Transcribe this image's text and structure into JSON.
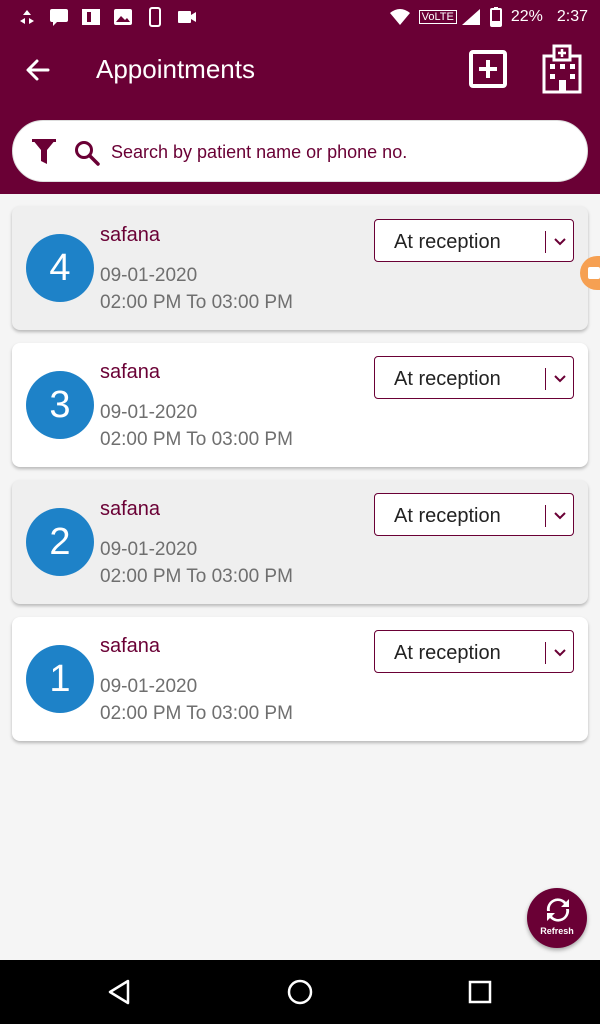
{
  "status_bar": {
    "network": "VoLTE",
    "battery": "22%",
    "time": "2:37"
  },
  "app_bar": {
    "title": "Appointments"
  },
  "search": {
    "placeholder": "Search by patient name or phone no.",
    "value": ""
  },
  "appointments": [
    {
      "number": "4",
      "name": "safana",
      "date": "09-01-2020",
      "time": "02:00 PM To 03:00 PM",
      "status": "At reception",
      "style": "grey"
    },
    {
      "number": "3",
      "name": "safana",
      "date": "09-01-2020",
      "time": "02:00 PM To 03:00 PM",
      "status": "At reception",
      "style": "white"
    },
    {
      "number": "2",
      "name": "safana",
      "date": "09-01-2020",
      "time": "02:00 PM To 03:00 PM",
      "status": "At reception",
      "style": "grey"
    },
    {
      "number": "1",
      "name": "safana",
      "date": "09-01-2020",
      "time": "02:00 PM To 03:00 PM",
      "status": "At reception",
      "style": "white"
    }
  ],
  "fab": {
    "label": "Refresh"
  },
  "colors": {
    "primary": "#6a0035",
    "number_badge": "#1e82c8",
    "card_grey": "#efefef",
    "card_white": "#ffffff",
    "side_tab": "#f6a052"
  },
  "icons": [
    "back-arrow-icon",
    "add-box-icon",
    "hospital-icon",
    "filter-icon",
    "search-icon",
    "chevron-down-icon",
    "refresh-icon",
    "nav-back-icon",
    "nav-home-icon",
    "nav-recent-icon"
  ]
}
